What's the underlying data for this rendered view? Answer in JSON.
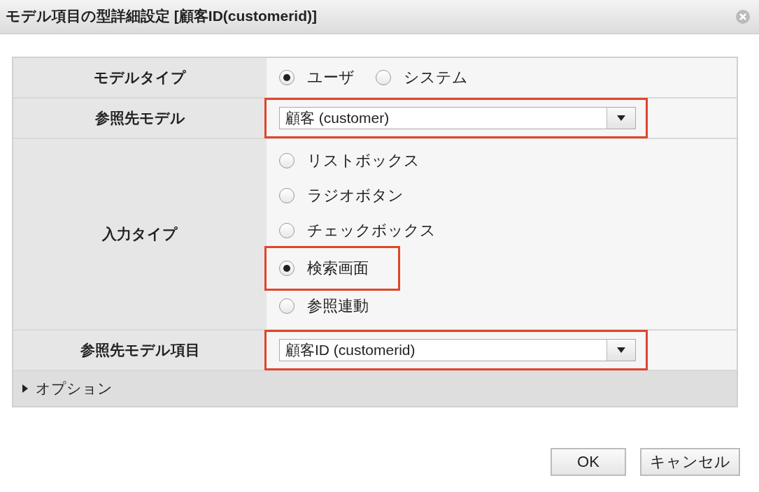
{
  "window": {
    "title": "モデル項目の型詳細設定 [顧客ID(customerid)]"
  },
  "form": {
    "rows": [
      {
        "kind": "radio-inline",
        "label": "モデルタイプ",
        "options": [
          {
            "label": "ユーザ",
            "selected": true,
            "highlighted": false
          },
          {
            "label": "システム",
            "selected": false,
            "highlighted": false
          }
        ]
      },
      {
        "kind": "select",
        "label": "参照先モデル",
        "value": "顧客 (customer)",
        "highlighted": true
      },
      {
        "kind": "radio-stack",
        "label": "入力タイプ",
        "options": [
          {
            "label": "リストボックス",
            "selected": false,
            "highlighted": false
          },
          {
            "label": "ラジオボタン",
            "selected": false,
            "highlighted": false
          },
          {
            "label": "チェックボックス",
            "selected": false,
            "highlighted": false
          },
          {
            "label": "検索画面",
            "selected": true,
            "highlighted": true
          },
          {
            "label": "参照連動",
            "selected": false,
            "highlighted": false
          }
        ]
      },
      {
        "kind": "select",
        "label": "参照先モデル項目",
        "value": "顧客ID (customerid)",
        "highlighted": true
      }
    ]
  },
  "options_section": {
    "label": "オプション",
    "expanded": false
  },
  "buttons": [
    {
      "label": "OK"
    },
    {
      "label": "キャンセル"
    }
  ]
}
